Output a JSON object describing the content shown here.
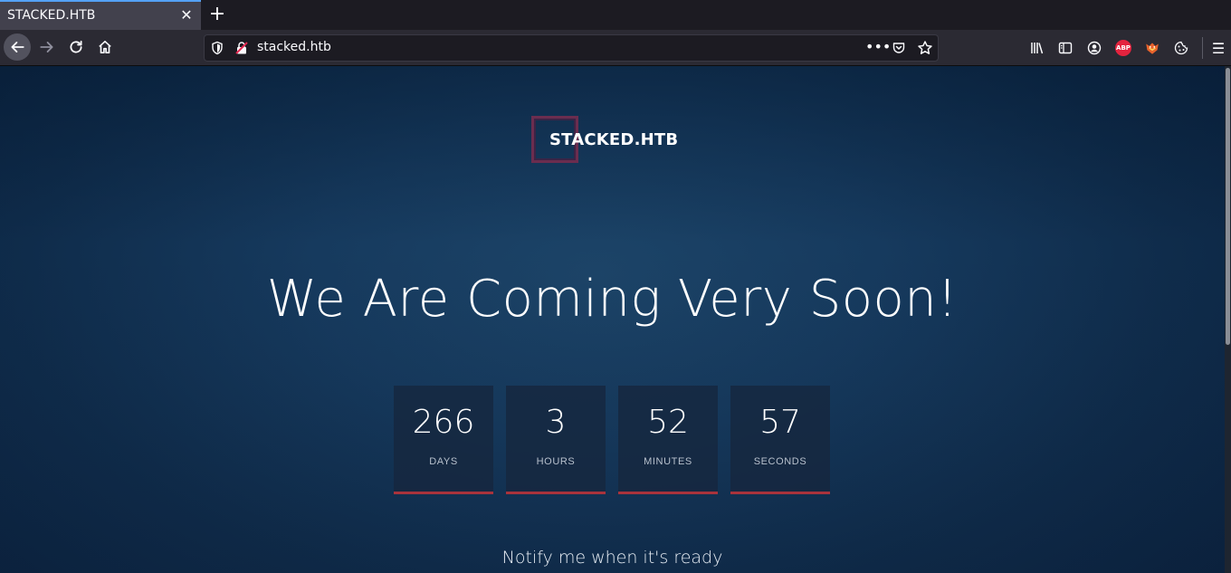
{
  "browser": {
    "tab": {
      "title": "STACKED.HTB",
      "close_glyph": "✕"
    },
    "new_tab_glyph": "+",
    "nav": {
      "back_icon": "arrow-left-icon",
      "forward_icon": "arrow-right-icon",
      "reload_icon": "reload-icon",
      "home_icon": "home-icon"
    },
    "urlbar": {
      "url": "stacked.htb",
      "more_glyph": "•••"
    },
    "toolbar": {
      "abp_label": "ABP",
      "menu_glyph": "☰"
    }
  },
  "page": {
    "logo_text": "STACKED.HTB",
    "headline": "We Are Coming Very Soon!",
    "countdown": [
      {
        "value": "266",
        "label": "DAYS"
      },
      {
        "value": "3",
        "label": "HOURS"
      },
      {
        "value": "52",
        "label": "MINUTES"
      },
      {
        "value": "57",
        "label": "SECONDS"
      }
    ],
    "notify_text": "Notify me when it's ready"
  },
  "colors": {
    "accent_underline": "#a8333c",
    "logo_border": "#6b2d4f",
    "tab_indicator": "#54a1f5"
  }
}
